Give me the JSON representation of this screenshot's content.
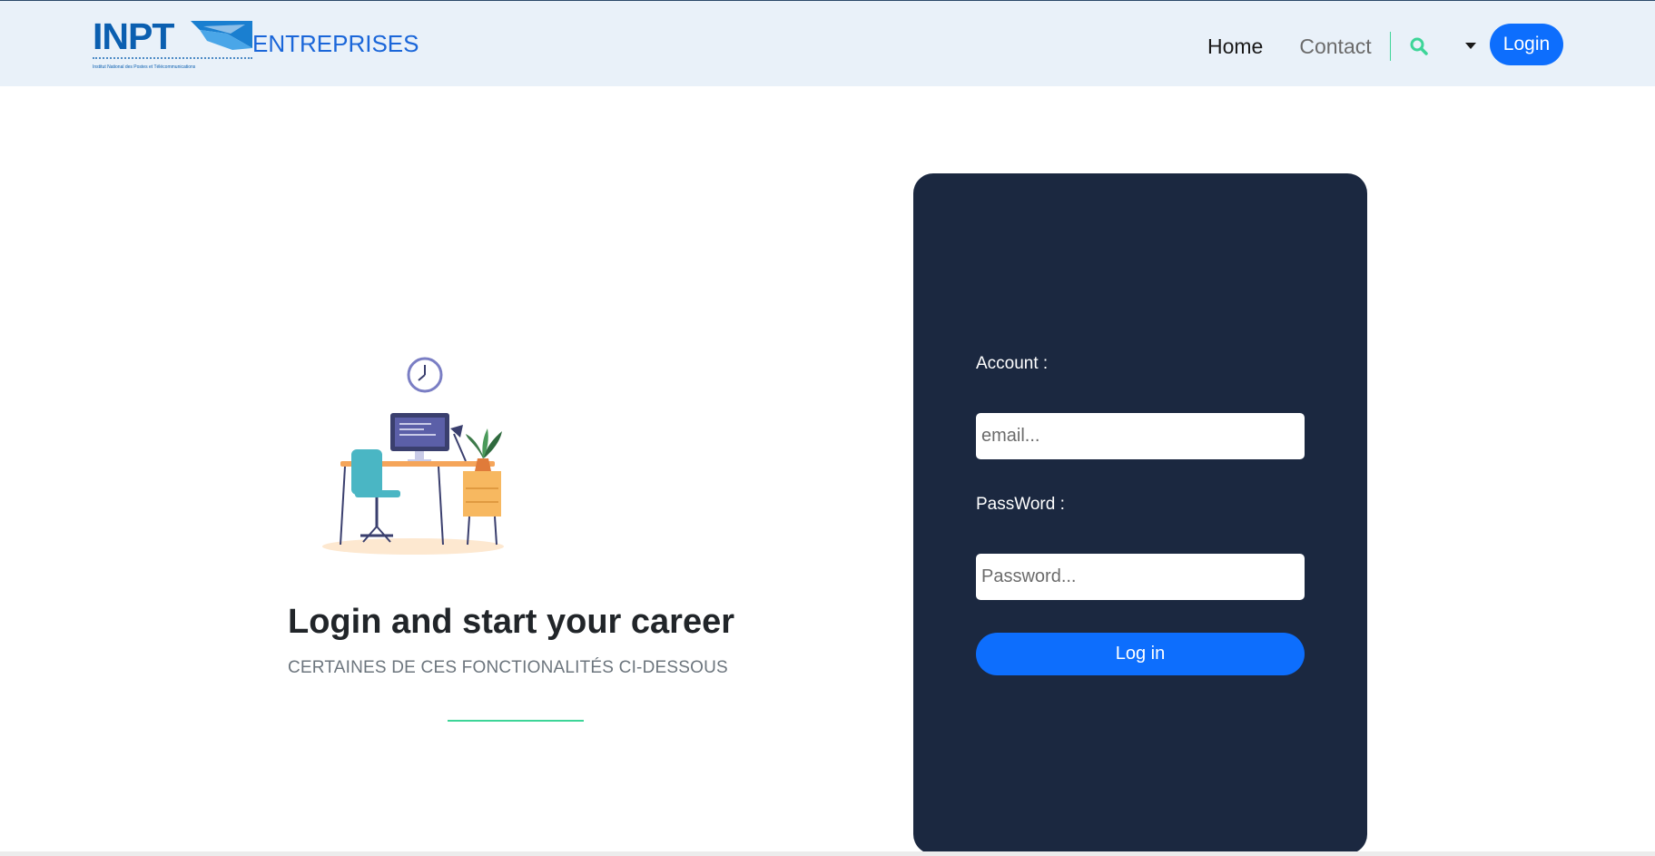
{
  "header": {
    "logo_text": "INPT",
    "logo_subtitle": "Institut National des Postes et Télécommunications",
    "brand_word": "ENTREPRISES",
    "nav": {
      "home": "Home",
      "contact": "Contact"
    },
    "search_icon": "search-icon",
    "dropdown_icon": "caret-down-icon",
    "login_label": "Login"
  },
  "hero": {
    "title": "Login and start your career",
    "subtitle": "CERTAINES DE CES FONCTIONALITÉS CI-DESSOUS"
  },
  "login_form": {
    "account_label": "Account :",
    "email_placeholder": "email...",
    "password_label": "PassWord :",
    "password_placeholder": "Password...",
    "submit_label": "Log in"
  },
  "colors": {
    "navbar_bg": "#e9f1f9",
    "primary": "#0d6efd",
    "accent": "#3dd598",
    "card_bg": "#1b2840",
    "brand_blue": "#1a66d9"
  }
}
